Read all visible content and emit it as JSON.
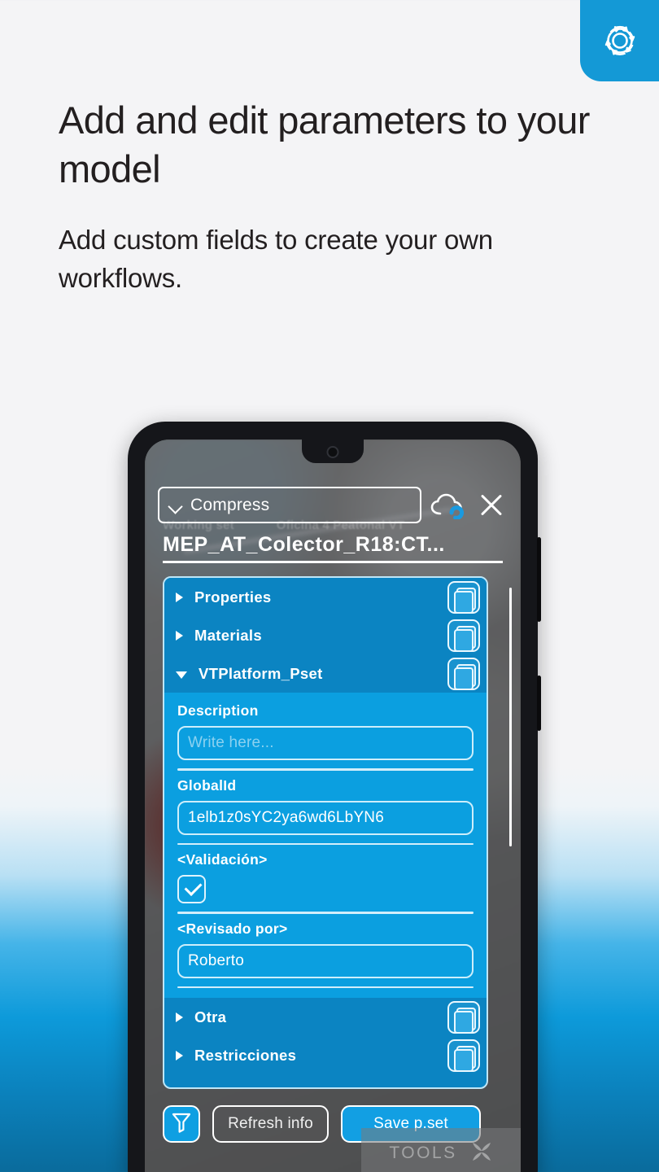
{
  "brand": {
    "logo_icon": "target-rings-icon",
    "logo_bg": "#1499d6"
  },
  "headline": "Add and edit parameters to your model",
  "subhead": "Add custom fields to create your own workflows.",
  "phone": {
    "screen": {
      "ghost_labels": [
        "Working set",
        "Oficina 4 Peatonal VT"
      ],
      "topbar": {
        "compress_label": "Compress",
        "chevron_icon": "chevron-down-icon",
        "cloud_icon": "cloud-sync-icon",
        "close_icon": "close-icon"
      },
      "doc_title": "MEP_AT_Colector_R18:CT...",
      "groups_top": [
        {
          "label": "Properties",
          "expanded": false,
          "copy_icon": "copy-icon"
        },
        {
          "label": "Materials",
          "expanded": false,
          "copy_icon": "copy-icon"
        },
        {
          "label": "VTPlatform_Pset",
          "expanded": true,
          "copy_icon": "copy-icon"
        }
      ],
      "fields": [
        {
          "label": "Description",
          "value": "",
          "placeholder": "Write here...",
          "type": "text"
        },
        {
          "label": "GlobalId",
          "value": "1elb1z0sYC2ya6wd6LbYN6",
          "placeholder": "",
          "type": "text"
        },
        {
          "label": "<Validación>",
          "value": "checked",
          "type": "checkbox"
        },
        {
          "label": "<Revisado por>",
          "value": "Roberto",
          "placeholder": "",
          "type": "text"
        }
      ],
      "groups_bottom": [
        {
          "label": "Otra",
          "expanded": false,
          "copy_icon": "copy-icon"
        },
        {
          "label": "Restricciones",
          "expanded": false,
          "copy_icon": "copy-icon"
        }
      ],
      "actions": {
        "filter_icon": "filter-funnel-icon",
        "refresh_label": "Refresh info",
        "save_label": "Save p.set"
      },
      "tools_label": "TOOLS",
      "tools_icon": "tools-cross-icon"
    }
  },
  "colors": {
    "accent_blue": "#0e9fe2",
    "panel_blue_dark": "#0b84c2",
    "panel_blue_light": "#0b9fe0",
    "page_bg_top": "#f4f4f6",
    "page_bg_bottom": "#0a6b9c"
  }
}
